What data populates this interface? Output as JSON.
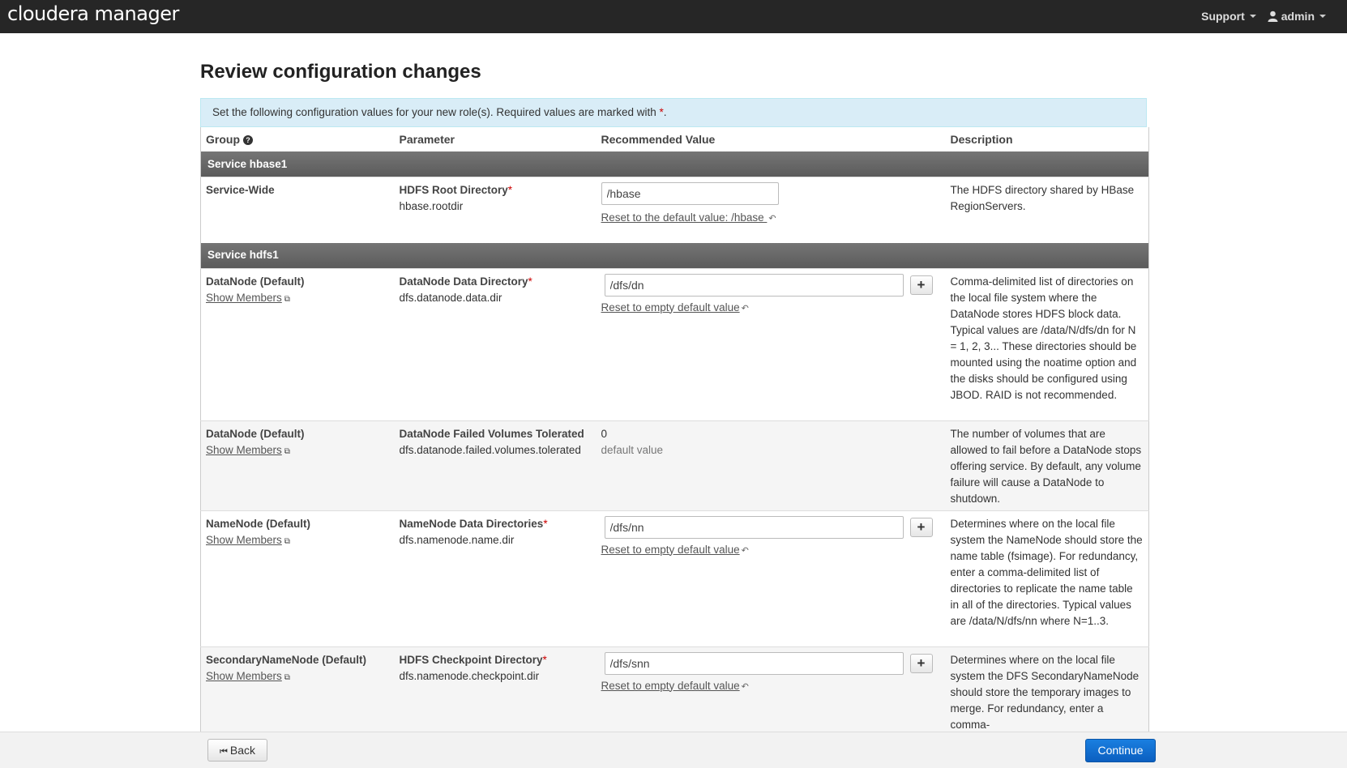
{
  "app": {
    "brand": "cloudera manager",
    "support_label": "Support",
    "user_label": "admin"
  },
  "page": {
    "title": "Review configuration changes",
    "info_text": "Set the following configuration values for your new role(s). Required values are marked with ",
    "info_star": "*",
    "info_end": "."
  },
  "table": {
    "headers": {
      "group": "Group",
      "parameter": "Parameter",
      "recommended": "Recommended Value",
      "description": "Description"
    },
    "sections": [
      {
        "title": "Service hbase1"
      },
      {
        "title": "Service hdfs1"
      }
    ],
    "rows": [
      {
        "group": "Service-Wide",
        "param_name": "HDFS Root Directory",
        "param_key": "hbase.rootdir",
        "value": "/hbase",
        "reset_text": "Reset to the default value: /hbase ",
        "description": "The HDFS directory shared by HBase RegionServers."
      },
      {
        "group": "DataNode (Default)",
        "show_members": "Show Members",
        "param_name": "DataNode Data Directory",
        "param_key": "dfs.datanode.data.dir",
        "value": "/dfs/dn",
        "reset_text": "Reset to empty default value",
        "description": "Comma-delimited list of directories on the local file system where the DataNode stores HDFS block data. Typical values are /data/N/dfs/dn for N = 1, 2, 3... These directories should be mounted using the noatime option and the disks should be configured using JBOD. RAID is not recommended."
      },
      {
        "group": "DataNode (Default)",
        "show_members": "Show Members",
        "param_name": "DataNode Failed Volumes Tolerated",
        "param_key": "dfs.datanode.failed.volumes.tolerated",
        "value": "0",
        "value_note": "default value",
        "description": "The number of volumes that are allowed to fail before a DataNode stops offering service. By default, any volume failure will cause a DataNode to shutdown."
      },
      {
        "group": "NameNode (Default)",
        "show_members": "Show Members",
        "param_name": "NameNode Data Directories",
        "param_key": "dfs.namenode.name.dir",
        "value": "/dfs/nn",
        "reset_text": "Reset to empty default value",
        "description": "Determines where on the local file system the NameNode should store the name table (fsimage). For redundancy, enter a comma-delimited list of directories to replicate the name table in all of the directories. Typical values are /data/N/dfs/nn where N=1..3."
      },
      {
        "group": "SecondaryNameNode (Default)",
        "show_members": "Show Members",
        "param_name": "HDFS Checkpoint Directory",
        "param_key": "dfs.namenode.checkpoint.dir",
        "value": "/dfs/snn",
        "reset_text": "Reset to empty default value",
        "description": "Determines where on the local file system the DFS SecondaryNameNode should store the temporary images to merge. For redundancy, enter a comma-"
      }
    ]
  },
  "footer": {
    "back_label": "Back",
    "continue_label": "Continue"
  },
  "colors": {
    "navbar": "#262626",
    "info_bg": "#d9edf7",
    "section_bg": "#666666",
    "primary_button": "#0b63c5"
  }
}
